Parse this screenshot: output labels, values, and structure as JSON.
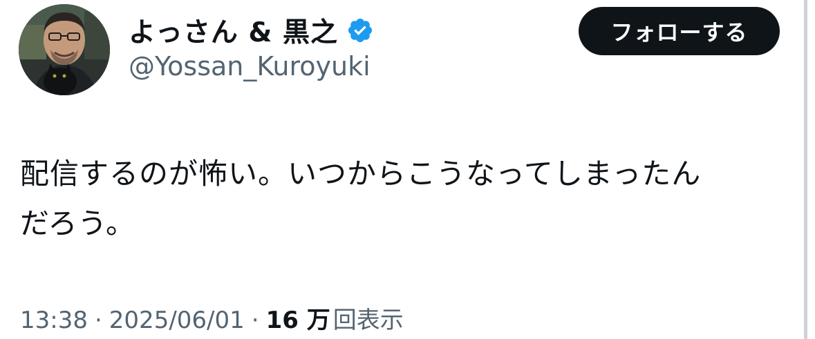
{
  "author": {
    "display_name": "よっさん & 黒之",
    "handle": "@Yossan_Kuroyuki",
    "verified": true
  },
  "follow_button": {
    "label": "フォローする"
  },
  "tweet": {
    "lines": [
      "配信するのが怖い。いつからこうなってしまったん",
      "だろう。"
    ]
  },
  "meta": {
    "time": "13:38",
    "separator": "·",
    "date": "2025/06/01",
    "views_count": "16 万",
    "views_label": "回表示"
  },
  "colors": {
    "text": "#0f1419",
    "secondary_text": "#536471",
    "button_bg": "#0f1419",
    "verified_badge": "#1d9bf0"
  },
  "icons": {
    "verified": "verified-badge-icon",
    "avatar": "profile-avatar"
  }
}
